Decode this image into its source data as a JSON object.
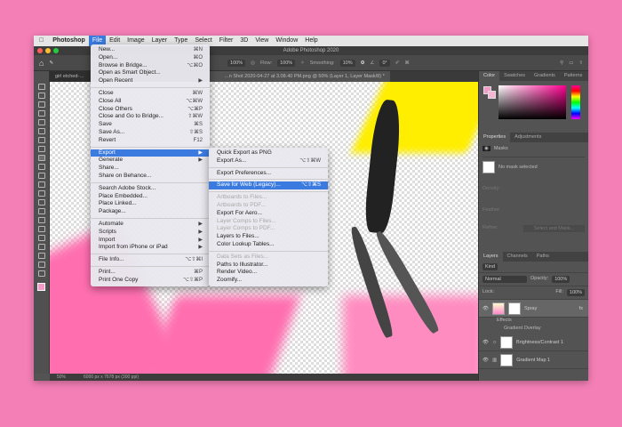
{
  "menubar": {
    "apple": "",
    "items": [
      "Photoshop",
      "File",
      "Edit",
      "Image",
      "Layer",
      "Type",
      "Select",
      "Filter",
      "3D",
      "View",
      "Window",
      "Help"
    ],
    "active": "File"
  },
  "window": {
    "title": "Adobe Photoshop 2020"
  },
  "options": {
    "opacity": "100%",
    "flow_label": "Flow:",
    "flow": "100%",
    "smoothing_label": "Smoothing:",
    "smoothing": "10%",
    "angle": "0°"
  },
  "tabs": [
    "girl etched-…",
    "…n Shot 2020-04-27 at 3.08.40 PM.png @ 50% (Layer 1, Layer Mask/8) *"
  ],
  "status": {
    "zoom": "50%",
    "doc": "6000 px x 7678 px (300 ppi)"
  },
  "file_menu": [
    {
      "label": "New...",
      "sc": "⌘N"
    },
    {
      "label": "Open...",
      "sc": "⌘O"
    },
    {
      "label": "Browse in Bridge...",
      "sc": "⌥⌘O"
    },
    {
      "label": "Open as Smart Object...",
      "sc": ""
    },
    {
      "label": "Open Recent",
      "sc": "▶"
    },
    {
      "sep": true
    },
    {
      "label": "Close",
      "sc": "⌘W"
    },
    {
      "label": "Close All",
      "sc": "⌥⌘W"
    },
    {
      "label": "Close Others",
      "sc": "⌥⌘P"
    },
    {
      "label": "Close and Go to Bridge...",
      "sc": "⇧⌘W"
    },
    {
      "label": "Save",
      "sc": "⌘S"
    },
    {
      "label": "Save As...",
      "sc": "⇧⌘S"
    },
    {
      "label": "Revert",
      "sc": "F12"
    },
    {
      "sep": true
    },
    {
      "label": "Export",
      "sc": "▶",
      "hl": true
    },
    {
      "label": "Generate",
      "sc": "▶"
    },
    {
      "label": "Share...",
      "sc": ""
    },
    {
      "label": "Share on Behance...",
      "sc": ""
    },
    {
      "sep": true
    },
    {
      "label": "Search Adobe Stock...",
      "sc": ""
    },
    {
      "label": "Place Embedded...",
      "sc": ""
    },
    {
      "label": "Place Linked...",
      "sc": ""
    },
    {
      "label": "Package...",
      "sc": ""
    },
    {
      "sep": true
    },
    {
      "label": "Automate",
      "sc": "▶"
    },
    {
      "label": "Scripts",
      "sc": "▶"
    },
    {
      "label": "Import",
      "sc": "▶"
    },
    {
      "label": "Import from iPhone or iPad",
      "sc": "▶"
    },
    {
      "sep": true
    },
    {
      "label": "File Info...",
      "sc": "⌥⇧⌘I"
    },
    {
      "sep": true
    },
    {
      "label": "Print...",
      "sc": "⌘P"
    },
    {
      "label": "Print One Copy",
      "sc": "⌥⇧⌘P"
    }
  ],
  "export_menu": [
    {
      "label": "Quick Export as PNG",
      "sc": ""
    },
    {
      "label": "Export As...",
      "sc": "⌥⇧⌘W"
    },
    {
      "sep": true
    },
    {
      "label": "Export Preferences...",
      "sc": ""
    },
    {
      "sep": true
    },
    {
      "label": "Save for Web (Legacy)...",
      "sc": "⌥⇧⌘S",
      "hl": true
    },
    {
      "sep": true
    },
    {
      "label": "Artboards to Files...",
      "sc": "",
      "dis": true
    },
    {
      "label": "Artboards to PDF...",
      "sc": "",
      "dis": true
    },
    {
      "label": "Export For Aero...",
      "sc": ""
    },
    {
      "label": "Layer Comps to Files...",
      "sc": "",
      "dis": true
    },
    {
      "label": "Layer Comps to PDF...",
      "sc": "",
      "dis": true
    },
    {
      "label": "Layers to Files...",
      "sc": ""
    },
    {
      "label": "Color Lookup Tables...",
      "sc": ""
    },
    {
      "sep": true
    },
    {
      "label": "Data Sets as Files...",
      "sc": "",
      "dis": true
    },
    {
      "label": "Paths to Illustrator...",
      "sc": ""
    },
    {
      "label": "Render Video...",
      "sc": ""
    },
    {
      "label": "Zoomify...",
      "sc": ""
    }
  ],
  "color_panel": {
    "tabs": [
      "Color",
      "Swatches",
      "Gradients",
      "Patterns"
    ],
    "foreground": "#f49ac8",
    "hue": "#ff0090"
  },
  "properties": {
    "tabs": [
      "Properties",
      "Adjustments"
    ],
    "section": "Masks",
    "no_mask": "No mask selected",
    "density": "Density:",
    "feather": "Feather:",
    "refine": "Refine:",
    "select_mask": "Select and Mask..."
  },
  "layers": {
    "tabs": [
      "Layers",
      "Channels",
      "Paths"
    ],
    "kind": "Kind",
    "blend": "Normal",
    "opacity_label": "Opacity:",
    "opacity": "100%",
    "lock_label": "Lock:",
    "fill_label": "Fill:",
    "fill": "100%",
    "items": [
      {
        "name": "Spray",
        "fx": "fx"
      },
      {
        "name": "Effects"
      },
      {
        "name": "Gradient Overlay"
      },
      {
        "name": "Brightness/Contrast 1"
      },
      {
        "name": "Gradient Map 1"
      }
    ]
  }
}
